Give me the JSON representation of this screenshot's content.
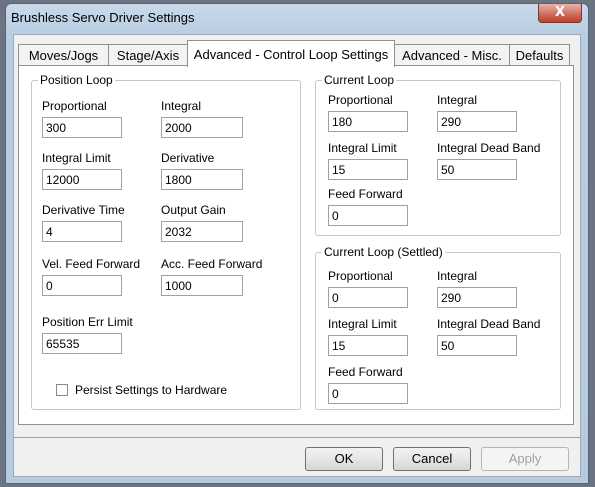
{
  "window": {
    "title": "Brushless Servo Driver Settings",
    "close_label": "X"
  },
  "tabs": [
    {
      "label": "Moves/Jogs"
    },
    {
      "label": "Stage/Axis"
    },
    {
      "label": "Advanced - Control Loop Settings"
    },
    {
      "label": "Advanced - Misc."
    },
    {
      "label": "Defaults"
    }
  ],
  "position_loop": {
    "title": "Position Loop",
    "proportional": {
      "label": "Proportional",
      "value": "300"
    },
    "integral": {
      "label": "Integral",
      "value": "2000"
    },
    "integral_limit": {
      "label": "Integral Limit",
      "value": "12000"
    },
    "derivative": {
      "label": "Derivative",
      "value": "1800"
    },
    "derivative_time": {
      "label": "Derivative Time",
      "value": "4"
    },
    "output_gain": {
      "label": "Output Gain",
      "value": "2032"
    },
    "vel_feed_forward": {
      "label": "Vel. Feed Forward",
      "value": "0"
    },
    "acc_feed_forward": {
      "label": "Acc. Feed Forward",
      "value": "1000"
    },
    "position_err_limit": {
      "label": "Position Err Limit",
      "value": "65535"
    }
  },
  "current_loop": {
    "title": "Current Loop",
    "proportional": {
      "label": "Proportional",
      "value": "180"
    },
    "integral": {
      "label": "Integral",
      "value": "290"
    },
    "integral_limit": {
      "label": "Integral Limit",
      "value": "15"
    },
    "integral_dead_band": {
      "label": "Integral Dead Band",
      "value": "50"
    },
    "feed_forward": {
      "label": "Feed Forward",
      "value": "0"
    }
  },
  "current_loop_settled": {
    "title": "Current Loop (Settled)",
    "proportional": {
      "label": "Proportional",
      "value": "0"
    },
    "integral": {
      "label": "Integral",
      "value": "290"
    },
    "integral_limit": {
      "label": "Integral Limit",
      "value": "15"
    },
    "integral_dead_band": {
      "label": "Integral Dead Band",
      "value": "50"
    },
    "feed_forward": {
      "label": "Feed Forward",
      "value": "0"
    }
  },
  "persist": {
    "label": "Persist Settings to Hardware",
    "checked": false
  },
  "buttons": {
    "ok": "OK",
    "cancel": "Cancel",
    "apply": "Apply"
  }
}
